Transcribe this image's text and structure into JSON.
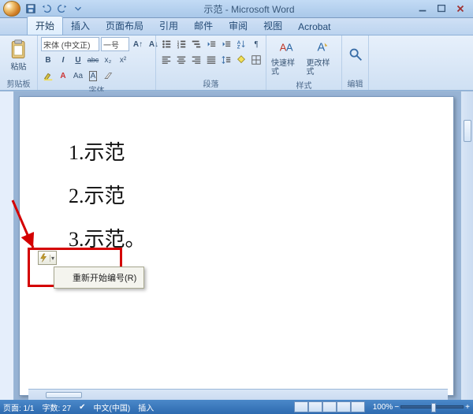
{
  "title": "示范 - Microsoft Word",
  "qat": {
    "save": "save",
    "undo": "undo",
    "redo": "redo"
  },
  "tabs": [
    "开始",
    "插入",
    "页面布局",
    "引用",
    "邮件",
    "审阅",
    "视图",
    "Acrobat"
  ],
  "active_tab": 0,
  "ribbon": {
    "clipboard": {
      "label": "剪贴板",
      "paste": "粘贴"
    },
    "font": {
      "label": "字体",
      "family": "宋体 (中文正)",
      "size": "一号",
      "buttons": {
        "bold": "B",
        "italic": "I",
        "underline": "U",
        "strike": "abc",
        "sub": "x₂",
        "sup": "x²"
      }
    },
    "paragraph": {
      "label": "段落"
    },
    "styles": {
      "label": "样式",
      "quick": "快速样式",
      "change": "更改样式"
    },
    "editing": {
      "label": "编辑"
    }
  },
  "document": {
    "list": [
      "示范",
      "示范",
      "示范。"
    ]
  },
  "smarttag_menu": {
    "restart_numbering": "重新开始编号(R)"
  },
  "status": {
    "page": "页面: 1/1",
    "words": "字数: 27",
    "lang": "中文(中国)",
    "mode": "插入",
    "zoom": "100%"
  }
}
